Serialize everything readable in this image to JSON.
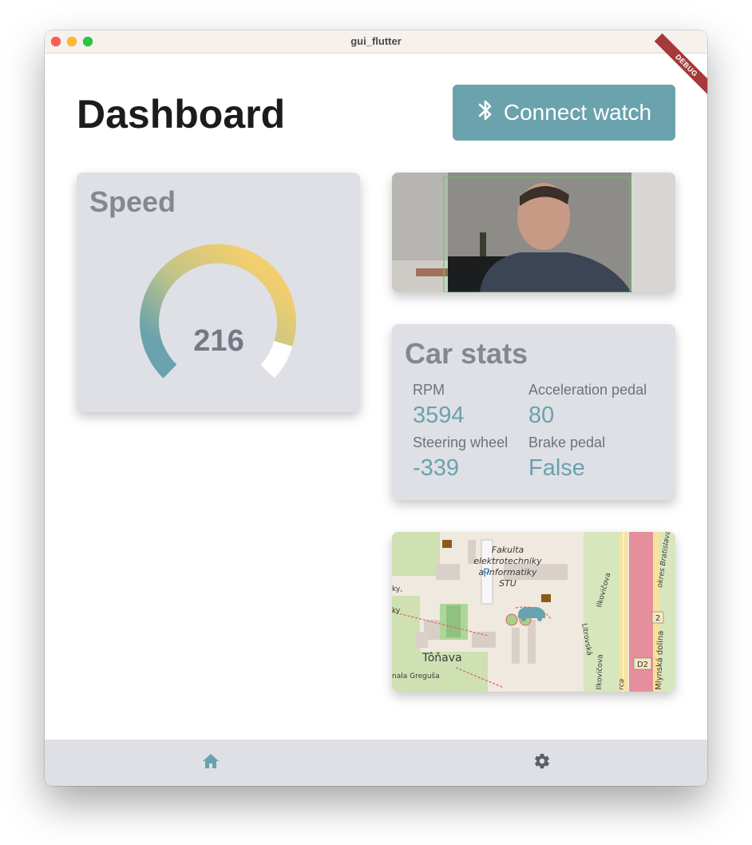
{
  "window": {
    "title": "gui_flutter",
    "debug_banner": "DEBUG"
  },
  "header": {
    "title": "Dashboard",
    "connect_button": {
      "label": "Connect watch",
      "icon": "bluetooth-icon"
    }
  },
  "speed": {
    "title": "Speed",
    "value": "216"
  },
  "car_stats": {
    "title": "Car stats",
    "items": [
      {
        "label": "RPM",
        "value": "3594"
      },
      {
        "label": "Acceleration pedal",
        "value": "80"
      },
      {
        "label": "Steering wheel",
        "value": "-339"
      },
      {
        "label": "Brake pedal",
        "value": "False"
      }
    ]
  },
  "map": {
    "labels": {
      "faculty": [
        "Fakulta",
        "elektrotechniky",
        "a informatiky",
        "STU"
      ],
      "tonava": "Tôňava",
      "greguse": "nala Greguša",
      "ilkovicova": "Ilkovičova",
      "ilkovicova2": "Ilkovičova",
      "mlynska": "Mlynská dolina",
      "bratislava": "okres Bratislava",
      "litrovska": "Litrovská",
      "parking": "P",
      "kyleft": "ky",
      "kyleft2": "ky,",
      "d2": "D2",
      "road2": "2",
      "rca": "rca"
    }
  },
  "bottom_nav": {
    "items": [
      {
        "icon": "home-icon"
      },
      {
        "icon": "gear-icon"
      }
    ]
  },
  "colors": {
    "accent": "#6aa2ad",
    "card": "#dee0e6",
    "gauge_start": "#6aa2ad",
    "gauge_end": "#f3ce6f"
  }
}
